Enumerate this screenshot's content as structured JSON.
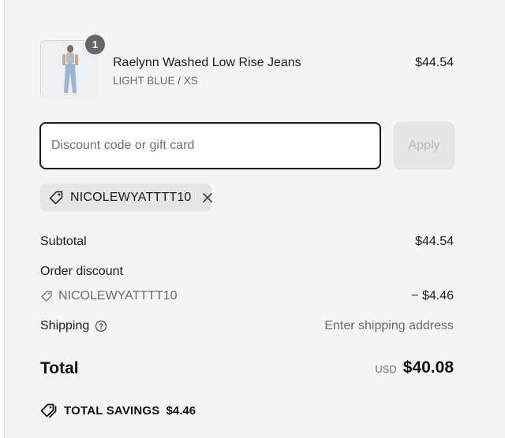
{
  "product": {
    "name": "Raelynn Washed Low Rise Jeans",
    "variant": "LIGHT BLUE / XS",
    "price": "$44.54",
    "quantity": "1",
    "thumbnail_icon": "product-photo"
  },
  "discount": {
    "placeholder": "Discount code or gift card",
    "value": "",
    "apply_label": "Apply",
    "applied_code": "NICOLEWYATTTT10",
    "tag_icon": "tag-icon",
    "remove_icon": "close-icon"
  },
  "summary": {
    "subtotal_label": "Subtotal",
    "subtotal_value": "$44.54",
    "order_discount_label": "Order discount",
    "discount_code": "NICOLEWYATTTT10",
    "discount_value": "− $4.46",
    "shipping_label": "Shipping",
    "shipping_value": "Enter shipping address",
    "help_icon": "help-circle-icon",
    "total_label": "Total",
    "currency": "USD",
    "total_value": "$40.08",
    "savings_label": "TOTAL SAVINGS",
    "savings_value": "$4.46",
    "savings_icon": "tags-icon"
  },
  "colors": {
    "panel_bg": "#f5f5f5",
    "text": "#1c1c1c",
    "muted": "#6b6b6b",
    "chip_bg": "#e6e6e6",
    "input_border": "#1a1a1a"
  }
}
